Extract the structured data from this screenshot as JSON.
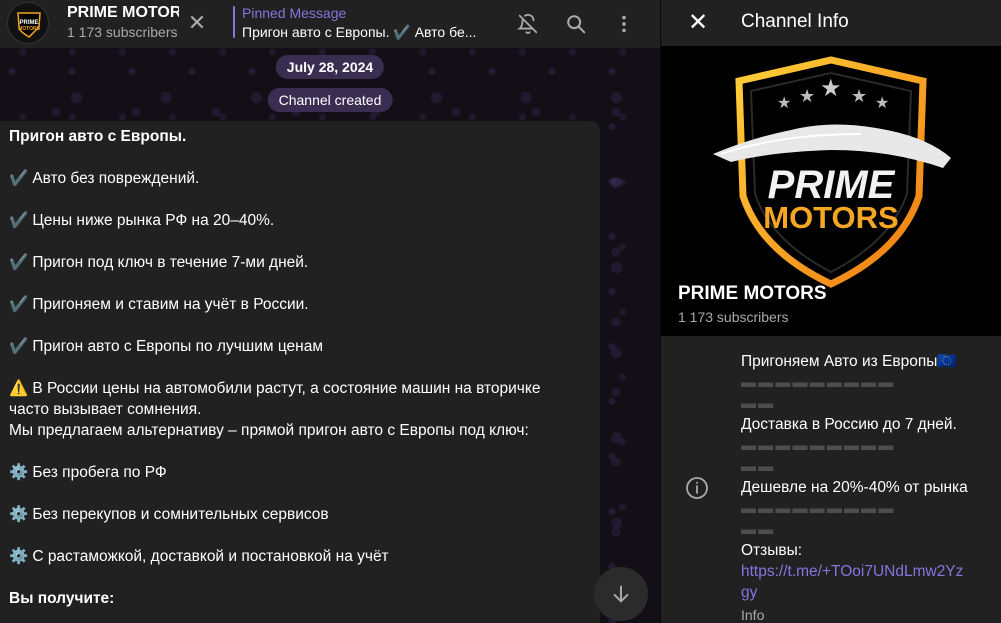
{
  "chat_header": {
    "title": "PRIME MOTORS",
    "subscribers": "1 173 subscribers",
    "pinned_label": "Pinned Message",
    "pinned_text": "Пригон авто с Европы. ✔️ Авто бе..."
  },
  "dates": {
    "date_pill": "July 28, 2024",
    "service_pill": "Channel created"
  },
  "message": {
    "title": "Пригон авто с Европы.",
    "checks": [
      "Авто без повреждений.",
      "Цены ниже рынка РФ на 20–40%.",
      "Пригон под ключ в течение 7-ми дней.",
      "Пригоняем и ставим на учёт в России.",
      "Пригон авто с Европы по лучшим ценам"
    ],
    "warn_line1": "В России цены на автомобили растут, а состояние машин на вторичке",
    "warn_line2": "часто вызывает сомнения.",
    "warn_line3": "Мы предлагаем альтернативу – прямой пригон авто с Европы под ключ:",
    "gears": [
      "Без пробега по РФ",
      "Без перекупов и сомнительных сервисов",
      "С растаможкой, доставкой и постановкой на учёт"
    ],
    "you_get": "Вы получите:"
  },
  "info_panel": {
    "title": "Channel Info",
    "channel_name": "PRIME MOTORS",
    "subscribers": "1 173 subscribers",
    "logo_line1": "PRIME",
    "logo_line2": "MOTORS",
    "description": {
      "line1": "Пригоняем Авто из Европы🇪🇺",
      "dashes": "▬ ▬ ▬ ▬ ▬ ▬ ▬ ▬ ▬",
      "dashes_short": "▬ ▬",
      "line2": "Доставка в Россию до 7 дней.",
      "line3": "Дешевле на 20%-40% от рынка",
      "reviews_label": "Отзывы:",
      "link_line1": "https://t.me/+TOoi7UNdLmw2Yz",
      "link_line2": "gy",
      "info_label": "Info"
    }
  },
  "icons": {
    "mute": "bell-off-icon",
    "search": "search-icon",
    "more": "more-vertical-icon",
    "close": "close-icon",
    "scroll": "arrow-down-icon",
    "info": "info-icon"
  },
  "colors": {
    "accent": "#8774e1",
    "pill_bg": "#3a2d52",
    "logo_orange": "#f5a623"
  }
}
